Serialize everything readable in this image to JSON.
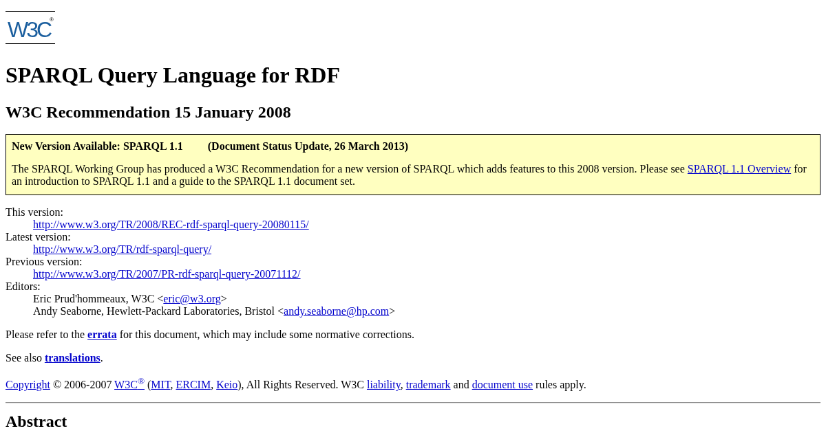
{
  "logo": {
    "text": "W3C",
    "mark": "®"
  },
  "title": "SPARQL Query Language for RDF",
  "subtitle": "W3C Recommendation 15 January 2008",
  "notice": {
    "title": "New Version Available: SPARQL 1.1",
    "status": "(Document Status Update, 26 March 2013)",
    "body": [
      {
        "kind": "text",
        "text": "The SPARQL Working Group has produced a W3C Recommendation for a new version of SPARQL which adds features to this 2008 version. Please see "
      },
      {
        "kind": "link",
        "text": "SPARQL 1.1 Overview"
      },
      {
        "kind": "text",
        "text": " for an introduction to SPARQL 1.1 and a guide to the SPARQL 1.1 document set."
      }
    ]
  },
  "metadata": [
    {
      "label": "This version:",
      "entries": [
        [
          {
            "kind": "link",
            "text": "http://www.w3.org/TR/2008/REC-rdf-sparql-query-20080115/"
          }
        ]
      ]
    },
    {
      "label": "Latest version:",
      "entries": [
        [
          {
            "kind": "link",
            "text": "http://www.w3.org/TR/rdf-sparql-query/"
          }
        ]
      ]
    },
    {
      "label": "Previous version:",
      "entries": [
        [
          {
            "kind": "link",
            "text": "http://www.w3.org/TR/2007/PR-rdf-sparql-query-20071112/"
          }
        ]
      ]
    },
    {
      "label": "Editors:",
      "entries": [
        [
          {
            "kind": "text",
            "text": "Eric Prud'hommeaux, W3C <"
          },
          {
            "kind": "link",
            "text": "eric@w3.org"
          },
          {
            "kind": "text",
            "text": ">"
          }
        ],
        [
          {
            "kind": "text",
            "text": "Andy Seaborne, Hewlett-Packard Laboratories, Bristol <"
          },
          {
            "kind": "link",
            "text": "andy.seaborne@hp.com"
          },
          {
            "kind": "text",
            "text": ">"
          }
        ]
      ]
    }
  ],
  "paragraphs": [
    [
      {
        "kind": "text",
        "text": "Please refer to the "
      },
      {
        "kind": "bold-link",
        "text": "errata"
      },
      {
        "kind": "text",
        "text": " for this document, which may include some normative corrections."
      }
    ],
    [
      {
        "kind": "text",
        "text": "See also "
      },
      {
        "kind": "bold-link",
        "text": "translations"
      },
      {
        "kind": "text",
        "text": "."
      }
    ]
  ],
  "copyright": [
    {
      "kind": "link",
      "text": "Copyright"
    },
    {
      "kind": "text",
      "text": " © 2006-2007 "
    },
    {
      "kind": "link",
      "text": "W3C$^{®}$"
    },
    {
      "kind": "text",
      "text": " ("
    },
    {
      "kind": "link",
      "text": "MIT"
    },
    {
      "kind": "text",
      "text": ", "
    },
    {
      "kind": "link",
      "text": "ERCIM"
    },
    {
      "kind": "text",
      "text": ", "
    },
    {
      "kind": "link",
      "text": "Keio"
    },
    {
      "kind": "text",
      "text": "), All Rights Reserved. W3C "
    },
    {
      "kind": "link",
      "text": "liability"
    },
    {
      "kind": "text",
      "text": ", "
    },
    {
      "kind": "link",
      "text": "trademark"
    },
    {
      "kind": "text",
      "text": " and "
    },
    {
      "kind": "link",
      "text": "document use"
    },
    {
      "kind": "text",
      "text": " rules apply."
    }
  ],
  "section_heading": "Abstract"
}
